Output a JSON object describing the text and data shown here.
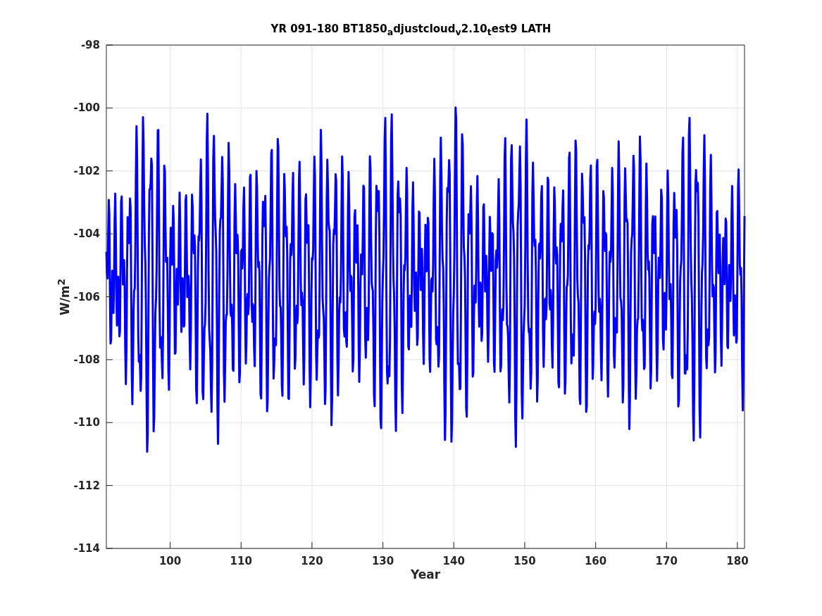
{
  "figure": {
    "title": "YR 091-180 BT1850$_{a}$djustcloud$_{v}$2.10$_{t}$est9 LATH",
    "xlabel": "Year",
    "ylabel": "W/m$^{2}$",
    "yticks": [
      "-98",
      "-100",
      "-102",
      "-104",
      "-106",
      "-108",
      "-110",
      "-112",
      "-114"
    ],
    "xticks": [
      "100",
      "110",
      "120",
      "130",
      "140",
      "150",
      "160",
      "170",
      "180"
    ]
  }
}
